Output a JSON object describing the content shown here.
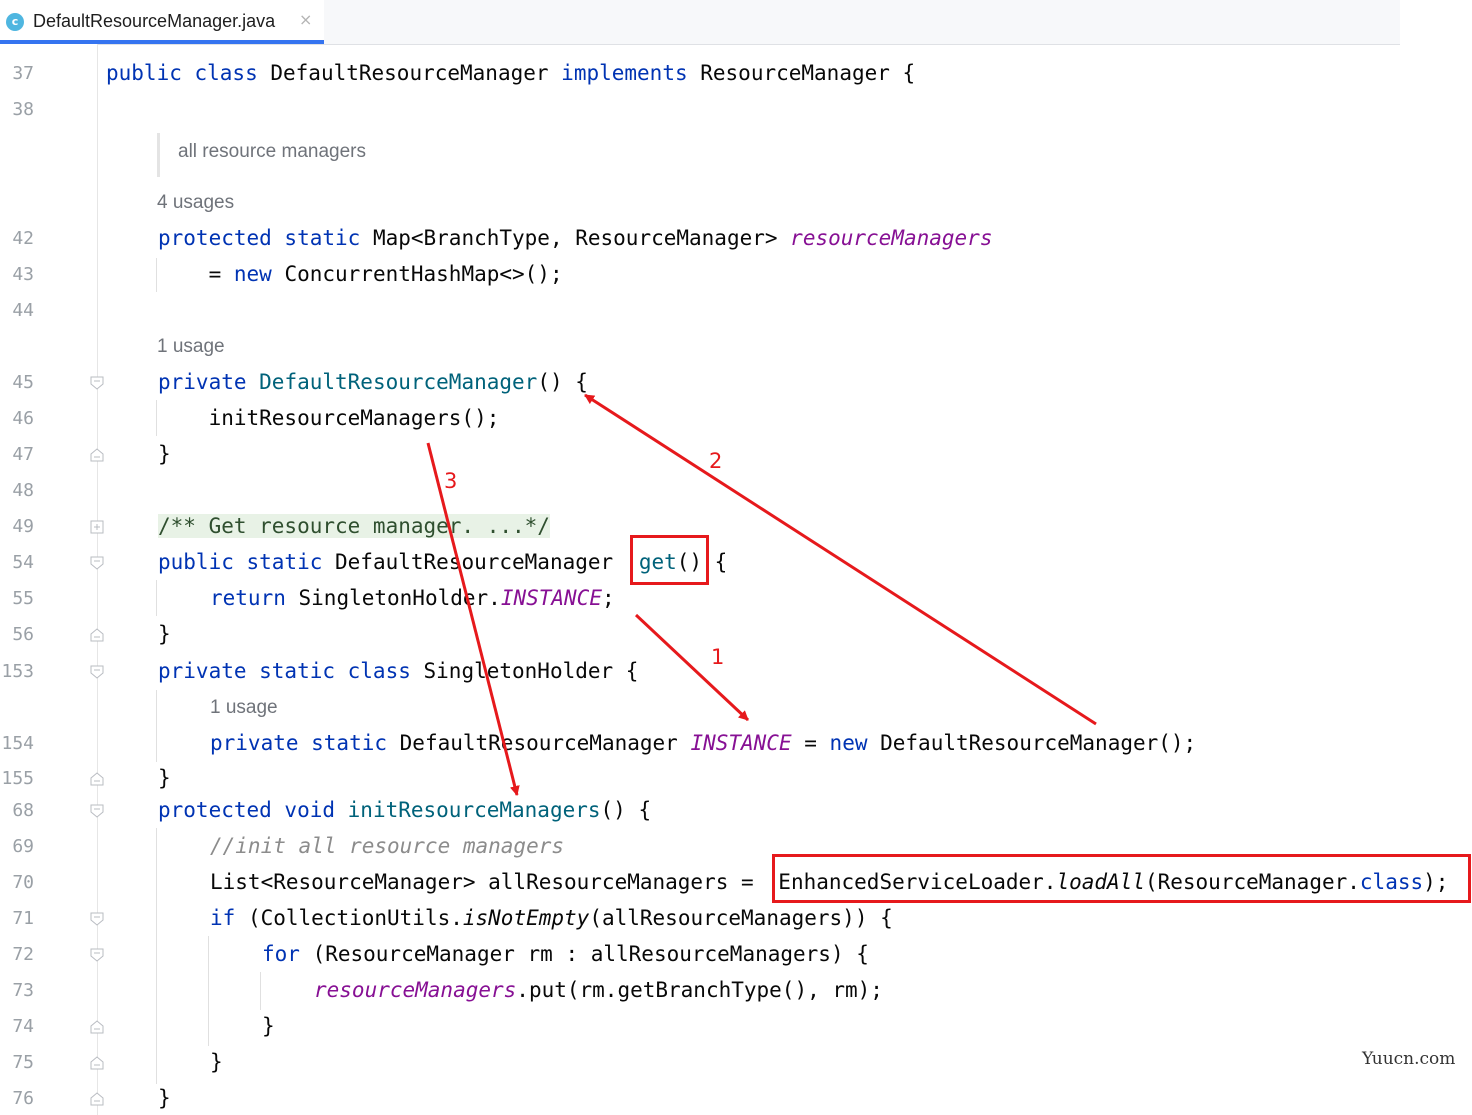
{
  "tab": {
    "icon": "c",
    "title": "DefaultResourceManager.java",
    "close": "×"
  },
  "gutter": {
    "line_numbers": [
      "37",
      "38",
      "42",
      "43",
      "44",
      "45",
      "46",
      "47",
      "48",
      "49",
      "54",
      "55",
      "56",
      "153",
      "154",
      "155",
      "68",
      "69",
      "70",
      "71",
      "72",
      "73",
      "74",
      "75",
      "76"
    ]
  },
  "hints": {
    "doc": "all resource managers",
    "usages_4": "4 usages",
    "usage_1a": "1 usage",
    "usage_1b": "1 usage"
  },
  "code": {
    "l37": {
      "kw1": "public class ",
      "name": "DefaultResourceManager ",
      "kw2": "implements ",
      "rest": "ResourceManager {"
    },
    "l42": {
      "kw": "protected static ",
      "type": "Map<BranchType, ResourceManager> ",
      "field": "resourceManagers"
    },
    "l43": {
      "pre": "    = ",
      "kw": "new ",
      "rest": "ConcurrentHashMap<>();"
    },
    "l45": {
      "kw": "private ",
      "fn": "DefaultResourceManager",
      "rest": "() {"
    },
    "l46": {
      "text": "    initResourceManagers();"
    },
    "l47": {
      "text": "}"
    },
    "l49": {
      "doc": "/** Get resource manager. ...*/"
    },
    "l54": {
      "kw": "public static ",
      "type": "DefaultResourceManager ",
      "fn": "get",
      "rest": "() {"
    },
    "l55": {
      "kw": "return ",
      "type": "SingletonHolder.",
      "field": "INSTANCE",
      "rest": ";"
    },
    "l56": {
      "text": "}"
    },
    "l153": {
      "kw": "private static class ",
      "rest": "SingletonHolder {"
    },
    "l154": {
      "kw": "private static ",
      "type": "DefaultResourceManager ",
      "field": "INSTANCE",
      "eq": " = ",
      "kw2": "new ",
      "rest": "DefaultResourceManager();"
    },
    "l155": {
      "text": "}"
    },
    "l68": {
      "kw": "protected void ",
      "fn": "initResourceManagers",
      "rest": "() {"
    },
    "l69": {
      "comment": "//init all resource managers"
    },
    "l70": {
      "pre": "List<ResourceManager> allResourceManagers = ",
      "cls": "EnhancedServiceLoader.",
      "method": "loadAll",
      "arg": "(ResourceManager.",
      "kw": "class",
      "end": ");"
    },
    "l71": {
      "kw": "if ",
      "pre": "(CollectionUtils.",
      "method": "isNotEmpty",
      "rest": "(allResourceManagers)) {"
    },
    "l72": {
      "kw": "for ",
      "rest": "(ResourceManager rm : allResourceManagers) {"
    },
    "l73": {
      "field": "resourceManagers",
      "rest": ".put(rm.getBranchType(), rm);"
    },
    "l74": {
      "text": "}"
    },
    "l75": {
      "text": "}"
    },
    "l76": {
      "text": "}"
    }
  },
  "annotations": {
    "label1": "1",
    "label2": "2",
    "label3": "3",
    "color": "#e6191c"
  },
  "watermark": "Yuucn.com"
}
